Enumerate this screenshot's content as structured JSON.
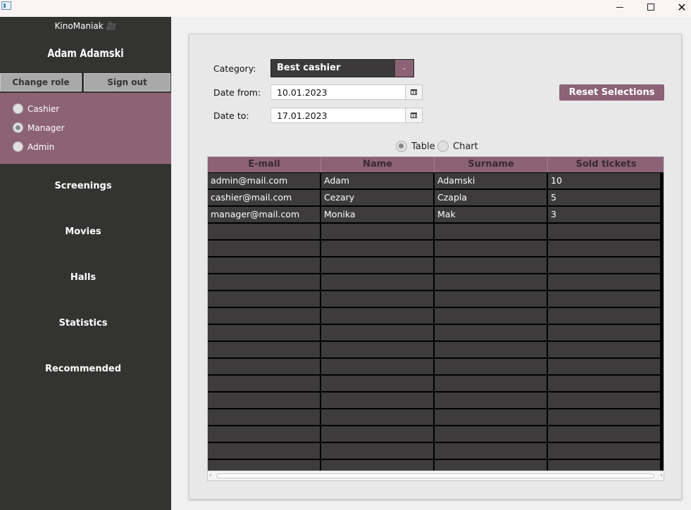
{
  "window": {
    "minimize": "",
    "maximize": "",
    "close": "✕"
  },
  "sidebar": {
    "brand": "KinoManiak 🎥",
    "user_name": "Adam Adamski",
    "change_role": "Change role",
    "sign_out": "Sign out",
    "roles": [
      {
        "label": "Cashier",
        "selected": false
      },
      {
        "label": "Manager",
        "selected": true
      },
      {
        "label": "Admin",
        "selected": false
      }
    ],
    "nav": [
      "Screenings",
      "Movies",
      "Halls",
      "Statistics",
      "Recommended"
    ]
  },
  "filters": {
    "category_label": "Category:",
    "category_value": "Best cashier",
    "date_from_label": "Date from:",
    "date_from_value": "10.01.2023",
    "date_to_label": "Date to:",
    "date_to_value": "17.01.2023",
    "reset_label": "Reset Selections"
  },
  "view": {
    "table_label": "Table",
    "chart_label": "Chart"
  },
  "table": {
    "columns": [
      "E-mail",
      "Name",
      "Surname",
      "Sold tickets"
    ],
    "rows": [
      [
        "admin@mail.com",
        "Adam",
        "Adamski",
        "10"
      ],
      [
        "cashier@mail.com",
        "Cezary",
        "Czapla",
        "5"
      ],
      [
        "manager@mail.com",
        "Monika",
        "Mak",
        "3"
      ]
    ]
  },
  "colors": {
    "accent": "#8c6275",
    "sidebar_bg": "#333332",
    "cell_bg": "#3d3b3c"
  }
}
